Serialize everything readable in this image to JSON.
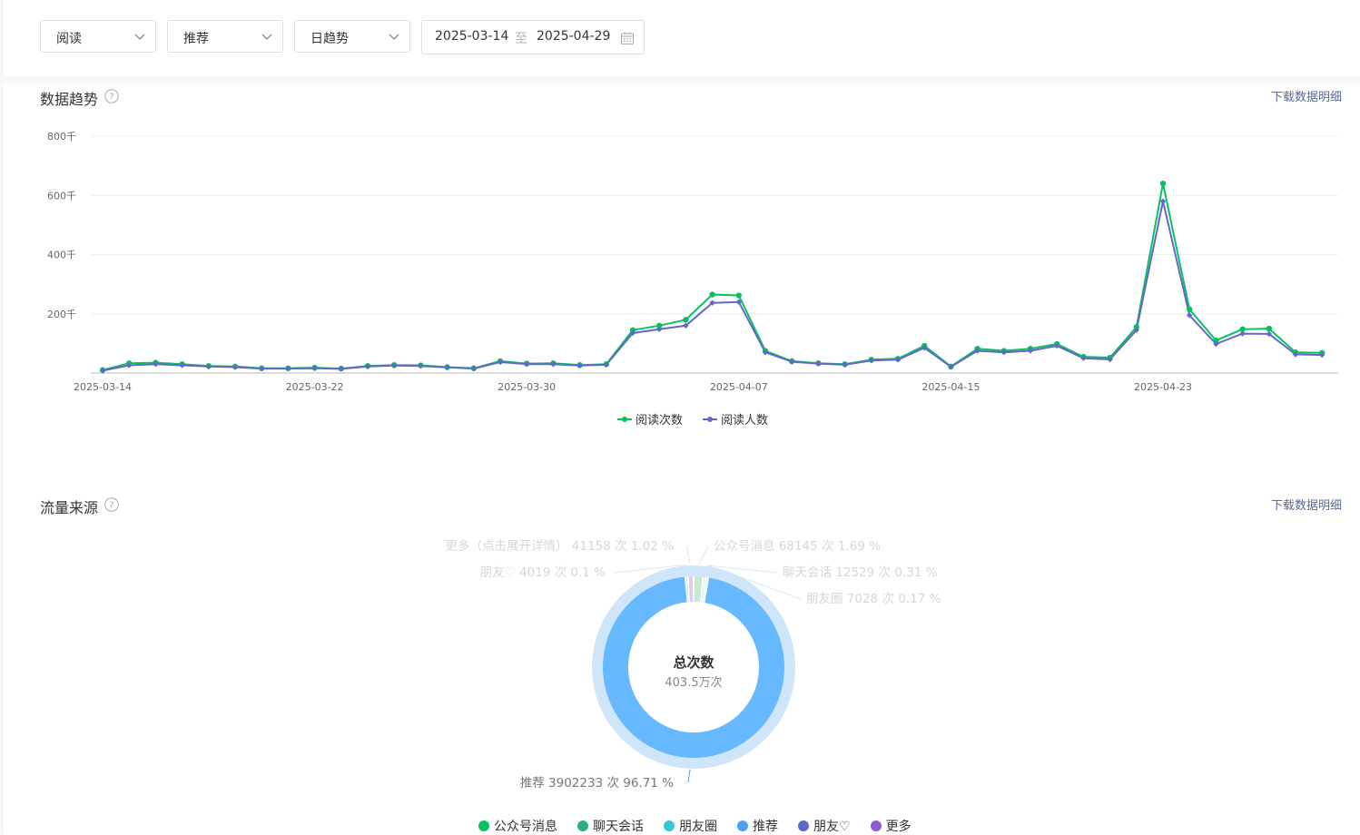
{
  "filters": {
    "metric": "阅读",
    "source": "推荐",
    "granularity": "日趋势",
    "date_start": "2025-03-14",
    "date_sep": "至",
    "date_end": "2025-04-29"
  },
  "trend": {
    "title": "数据趋势",
    "download": "下载数据明细"
  },
  "traffic": {
    "title": "流量来源",
    "download": "下载数据明细",
    "center_title": "总次数",
    "center_value": "403.5万次"
  },
  "colors": {
    "reads": "#07c160",
    "readers": "#6467c8",
    "link": "#576b95",
    "donut_main": "#66b8ff",
    "donut_ring": "#cfe5f9"
  },
  "chart_data": [
    {
      "type": "line",
      "title": "",
      "y_ticks": [
        "800千",
        "600千",
        "400千",
        "200千"
      ],
      "x_tick_labels": [
        "2025-03-14",
        "2025-03-22",
        "2025-03-30",
        "2025-04-07",
        "2025-04-15",
        "2025-04-23"
      ],
      "ylim": [
        0,
        800000
      ],
      "x_start": "2025-03-14",
      "x_end": "2025-04-29",
      "series": [
        {
          "name": "阅读次数",
          "values": [
            10000,
            33000,
            35000,
            30000,
            24000,
            22000,
            16000,
            16000,
            18000,
            15000,
            24000,
            27000,
            26000,
            20000,
            16000,
            40000,
            32000,
            33000,
            27000,
            30000,
            145000,
            160000,
            180000,
            265000,
            262000,
            75000,
            40000,
            33000,
            30000,
            45000,
            48000,
            92000,
            22000,
            82000,
            75000,
            82000,
            98000,
            55000,
            52000,
            155000,
            640000,
            215000,
            110000,
            148000,
            150000,
            70000,
            68000
          ]
        },
        {
          "name": "阅读人数",
          "values": [
            8000,
            26000,
            30000,
            26000,
            22000,
            20000,
            15000,
            15000,
            16000,
            14000,
            22000,
            25000,
            24000,
            19000,
            15000,
            37000,
            30000,
            30000,
            25000,
            28000,
            135000,
            148000,
            160000,
            237000,
            240000,
            70000,
            38000,
            32000,
            28000,
            42000,
            45000,
            85000,
            21000,
            75000,
            70000,
            75000,
            92000,
            50000,
            46000,
            145000,
            580000,
            195000,
            98000,
            133000,
            132000,
            63000,
            61000
          ]
        }
      ],
      "legend": [
        "阅读次数",
        "阅读人数"
      ]
    },
    {
      "type": "pie",
      "total_label": "总次数",
      "total_value": "403.5万次",
      "slices": [
        {
          "name": "公众号消息",
          "value": 68145,
          "percent": 1.69,
          "label": "公众号消息 68145 次 1.69 %",
          "color": "#07c160"
        },
        {
          "name": "聊天会话",
          "value": 12529,
          "percent": 0.31,
          "label": "聊天会话 12529 次 0.31 %",
          "color": "#2aae84"
        },
        {
          "name": "朋友圈",
          "value": 7028,
          "percent": 0.17,
          "label": "朋友圈 7028 次 0.17 %",
          "color": "#35c7d8"
        },
        {
          "name": "推荐",
          "value": 3902233,
          "percent": 96.71,
          "label": "推荐 3902233 次 96.71 %",
          "color": "#4aa3f0"
        },
        {
          "name": "朋友♡",
          "value": 4019,
          "percent": 0.1,
          "label": "朋友♡ 4019 次 0.1 %",
          "color": "#5b6ac4"
        },
        {
          "name": "更多",
          "value": 41158,
          "percent": 1.02,
          "label": "更多（点击展开详情） 41158 次 1.02 %",
          "color": "#8f5ad0"
        }
      ],
      "legend": [
        "公众号消息",
        "聊天会话",
        "朋友圈",
        "推荐",
        "朋友♡",
        "更多"
      ]
    }
  ]
}
